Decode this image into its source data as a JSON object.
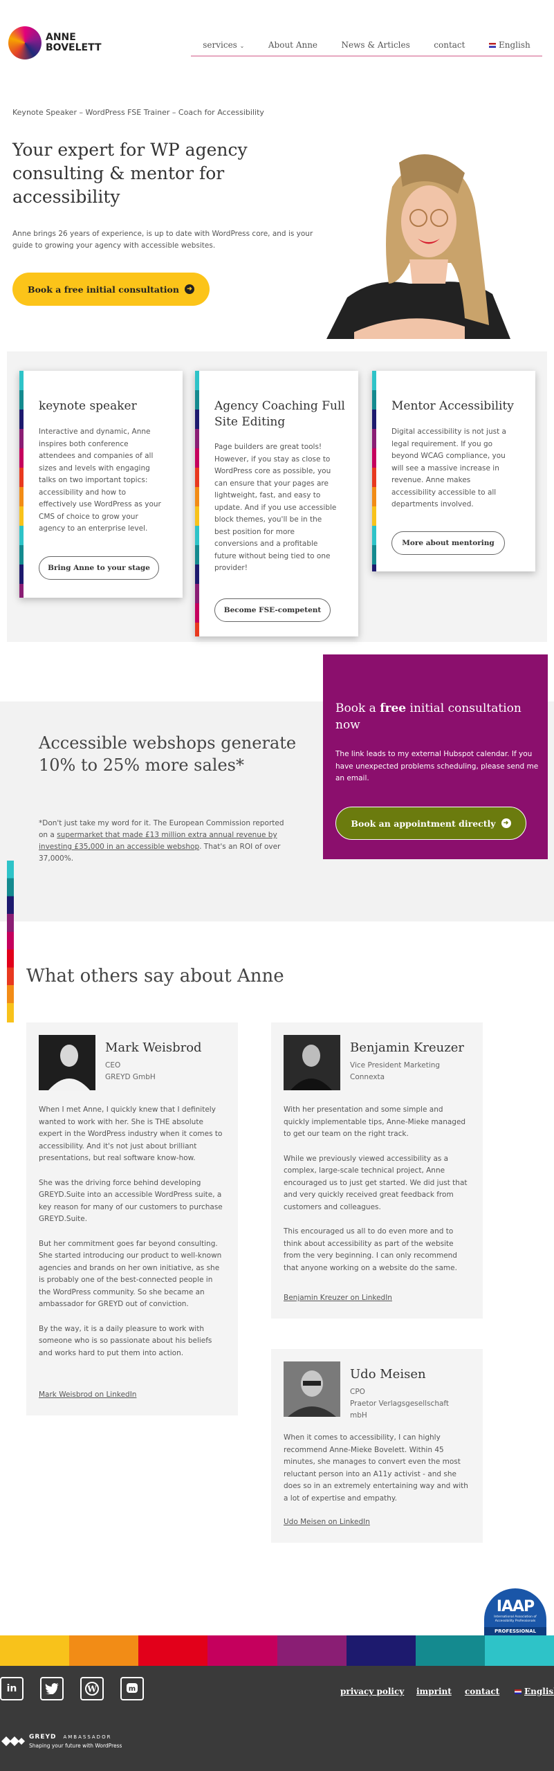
{
  "header": {
    "logo_line1": "ANNE",
    "logo_line2": "BOVELETT",
    "nav": {
      "services": "services",
      "about": "About Anne",
      "news": "News & Articles",
      "contact": "contact",
      "language": "English"
    }
  },
  "hero": {
    "tagline": "Keynote Speaker – WordPress FSE Trainer – Coach for Accessibility",
    "title": "Your expert for WP agency consulting & mentor for accessibility",
    "subtitle": "Anne brings 26 years of experience, is up to date with WordPress core, and is your guide to growing your agency with accessible websites.",
    "cta": "Book a free initial consultation"
  },
  "cards": [
    {
      "title": "keynote speaker",
      "body": "Interactive and dynamic, Anne inspires both conference attendees and companies of all sizes and levels with engaging talks on two important topics: accessibility and how to effectively use WordPress as your CMS of choice to grow your agency to an enterprise level.",
      "button": "Bring Anne to your stage"
    },
    {
      "title": "Agency Coaching Full Site Editing",
      "body": "Page builders are great tools! However, if you stay as close to WordPress core as possible, you can ensure that your pages are lightweight, fast, and easy to update. And if you use accessible block themes, you'll be in the best position for more conversions and a profitable future without being tied to one provider!",
      "button": "Become FSE-competent"
    },
    {
      "title": "Mentor Accessibility",
      "body": "Digital accessibility is not just a legal requirement. If you go beyond WCAG compliance, you will see a massive increase in revenue. Anne makes accessibility accessible to all departments involved.",
      "button": "More about mentoring"
    }
  ],
  "webshops": {
    "title": "Accessible webshops generate 10% to 25% more sales*",
    "note_before": "*Don't just take my word for it. The European Commission reported on a ",
    "note_link": "supermarket that made £13 million extra annual revenue by investing £35,000 in an accessible webshop",
    "note_after": ". That's an ROI of over 37,000%."
  },
  "consult_box": {
    "title_pre": "Book a ",
    "title_bold": "free",
    "title_post": " initial consultation now",
    "body": "The link leads to my external Hubspot calendar. If you have unexpected problems scheduling, please send me an email.",
    "button": "Book an appointment directly"
  },
  "testimonials": {
    "heading": "What others say about Anne",
    "items": [
      {
        "name": "Mark Weisbrod",
        "role": "CEO",
        "company": "GREYD GmbH",
        "paragraphs": [
          "When I met Anne, I quickly knew that I definitely wanted to work with her. She is THE absolute expert in the WordPress industry when it comes to accessibility. And it's not just about brilliant presentations, but real software know-how.",
          "She was the driving force behind developing GREYD.Suite into an accessible WordPress suite, a key reason for many of our customers to purchase GREYD.Suite.",
          "But her commitment goes far beyond consulting. She started introducing our product to well-known agencies and brands on her own initiative, as she is probably one of the best-connected people in the WordPress community. So she became an ambassador for GREYD out of conviction.",
          "By the way, it is a daily pleasure to work with someone who is so passionate about his beliefs and works hard to put them into action."
        ],
        "link": "Mark Weisbrod on LinkedIn"
      },
      {
        "name": "Benjamin Kreuzer",
        "role": "Vice President Marketing",
        "company": "Connexta",
        "paragraphs": [
          "With her presentation and some simple and quickly implementable tips, Anne-Mieke managed to get our team on the right track.",
          "While we previously viewed accessibility as a complex, large-scale technical project, Anne encouraged us to just get started. We did just that and very quickly received great feedback from customers and colleagues.",
          "This encouraged us all to do even more and to think about accessibility as part of the website from the very beginning. I can only recommend that anyone working on a website do the same."
        ],
        "link": "Benjamin Kreuzer on LinkedIn"
      },
      {
        "name": "Udo Meisen",
        "role": "CPO",
        "company": "Praetor Verlagsgesellschaft mbH",
        "paragraphs": [
          "When it comes to accessibility, I can highly recommend Anne-Mieke Bovelett. Within 45 minutes, she manages to convert even the most reluctant person into an A11y activist - and she does so in an extremely entertaining way and with a lot of expertise and empathy."
        ],
        "link": "Udo Meisen on LinkedIn"
      }
    ]
  },
  "iaap": {
    "logo": "IAAP",
    "org": "International Association of Accessibility Professionals",
    "level": "PROFESSIONAL"
  },
  "footer": {
    "band_colors": [
      "#f8c21b",
      "#f28c16",
      "#e2001a",
      "#c5005d",
      "#8a1e74",
      "#1d1a6e",
      "#148a8f",
      "#2ec3c8"
    ],
    "social": [
      "linkedin-icon",
      "twitter-icon",
      "wordpress-icon",
      "mastodon-icon"
    ],
    "links": {
      "privacy": "privacy policy",
      "imprint": "imprint",
      "contact": "contact",
      "language": "English"
    },
    "greyd_name": "GREYD",
    "greyd_badge": "AMBASSADOR",
    "greyd_slogan": "Shaping your future with WordPress"
  }
}
